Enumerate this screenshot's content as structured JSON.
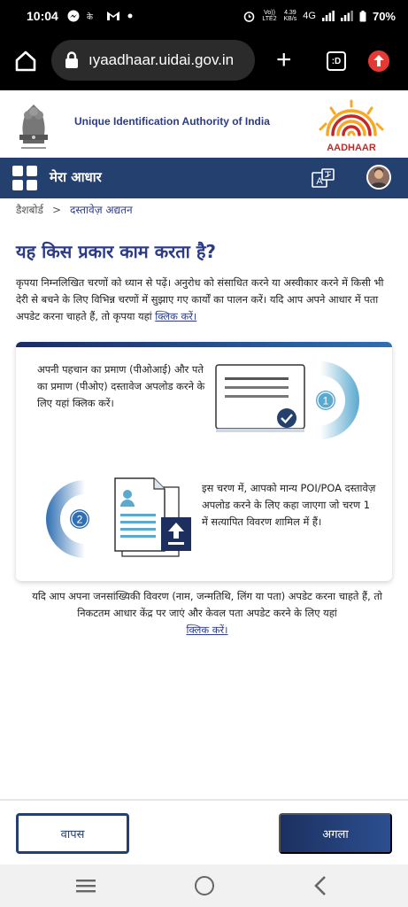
{
  "status_bar": {
    "time": "10:04",
    "volte": "Vo)) LTE2",
    "speed_value": "4.39",
    "speed_unit": "KB/s",
    "network": "4G",
    "battery": "70%"
  },
  "browser": {
    "url": "ıyaadhaar.uidai.gov.in",
    "tab_count": ":D"
  },
  "header": {
    "org_name": "Unique Identification Authority of India",
    "logo_text": "AADHAAR"
  },
  "nav": {
    "title": "मेरा आधार"
  },
  "breadcrumb": {
    "home": "डैशबोर्ड",
    "separator": ">",
    "current": "दस्तावेज़ अद्यतन"
  },
  "page": {
    "title": "यह किस प्रकार काम करता है?",
    "intro_text": "कृपया निम्नलिखित चरणों को ध्यान से पढ़ें। अनुरोध को संसाधित करने या अस्वीकार करने में किसी भी देरी से बचने के लिए विभिन्न चरणों में सुझाए गए कार्यों का पालन करें। यदि आप अपने आधार में पता अपडेट करना चाहते हैं, तो कृपया यहां",
    "intro_link": "क्लिक करें।"
  },
  "steps": [
    {
      "number": "1",
      "text": "अपनी पहचान का प्रमाण (पीओआई) और पते का प्रमाण (पीओए) दस्तावेज अपलोड करने के लिए यहां क्लिक करें।"
    },
    {
      "number": "2",
      "text": "इस चरण में, आपको मान्य POI/POA दस्तावेज़ अपलोड करने के लिए कहा जाएगा जो चरण 1 में सत्यापित विवरण शामिल में हैं।"
    }
  ],
  "note": {
    "text": "यदि आप अपना जनसांख्यिकी विवरण (नाम, जन्मतिथि, लिंग या पता) अपडेट करना चाहते हैं, तो निकटतम आधार केंद्र पर जाएं और केवल पता अपडेट करने के लिए यहां",
    "link": "क्लिक करें।"
  },
  "buttons": {
    "back": "वापस",
    "next": "अगला"
  },
  "colors": {
    "primary_blue": "#23406f",
    "title_blue": "#2c3b87",
    "aadhaar_red": "#c62828",
    "aadhaar_yellow": "#f9a825",
    "step_circle": "#5aa9cf"
  }
}
